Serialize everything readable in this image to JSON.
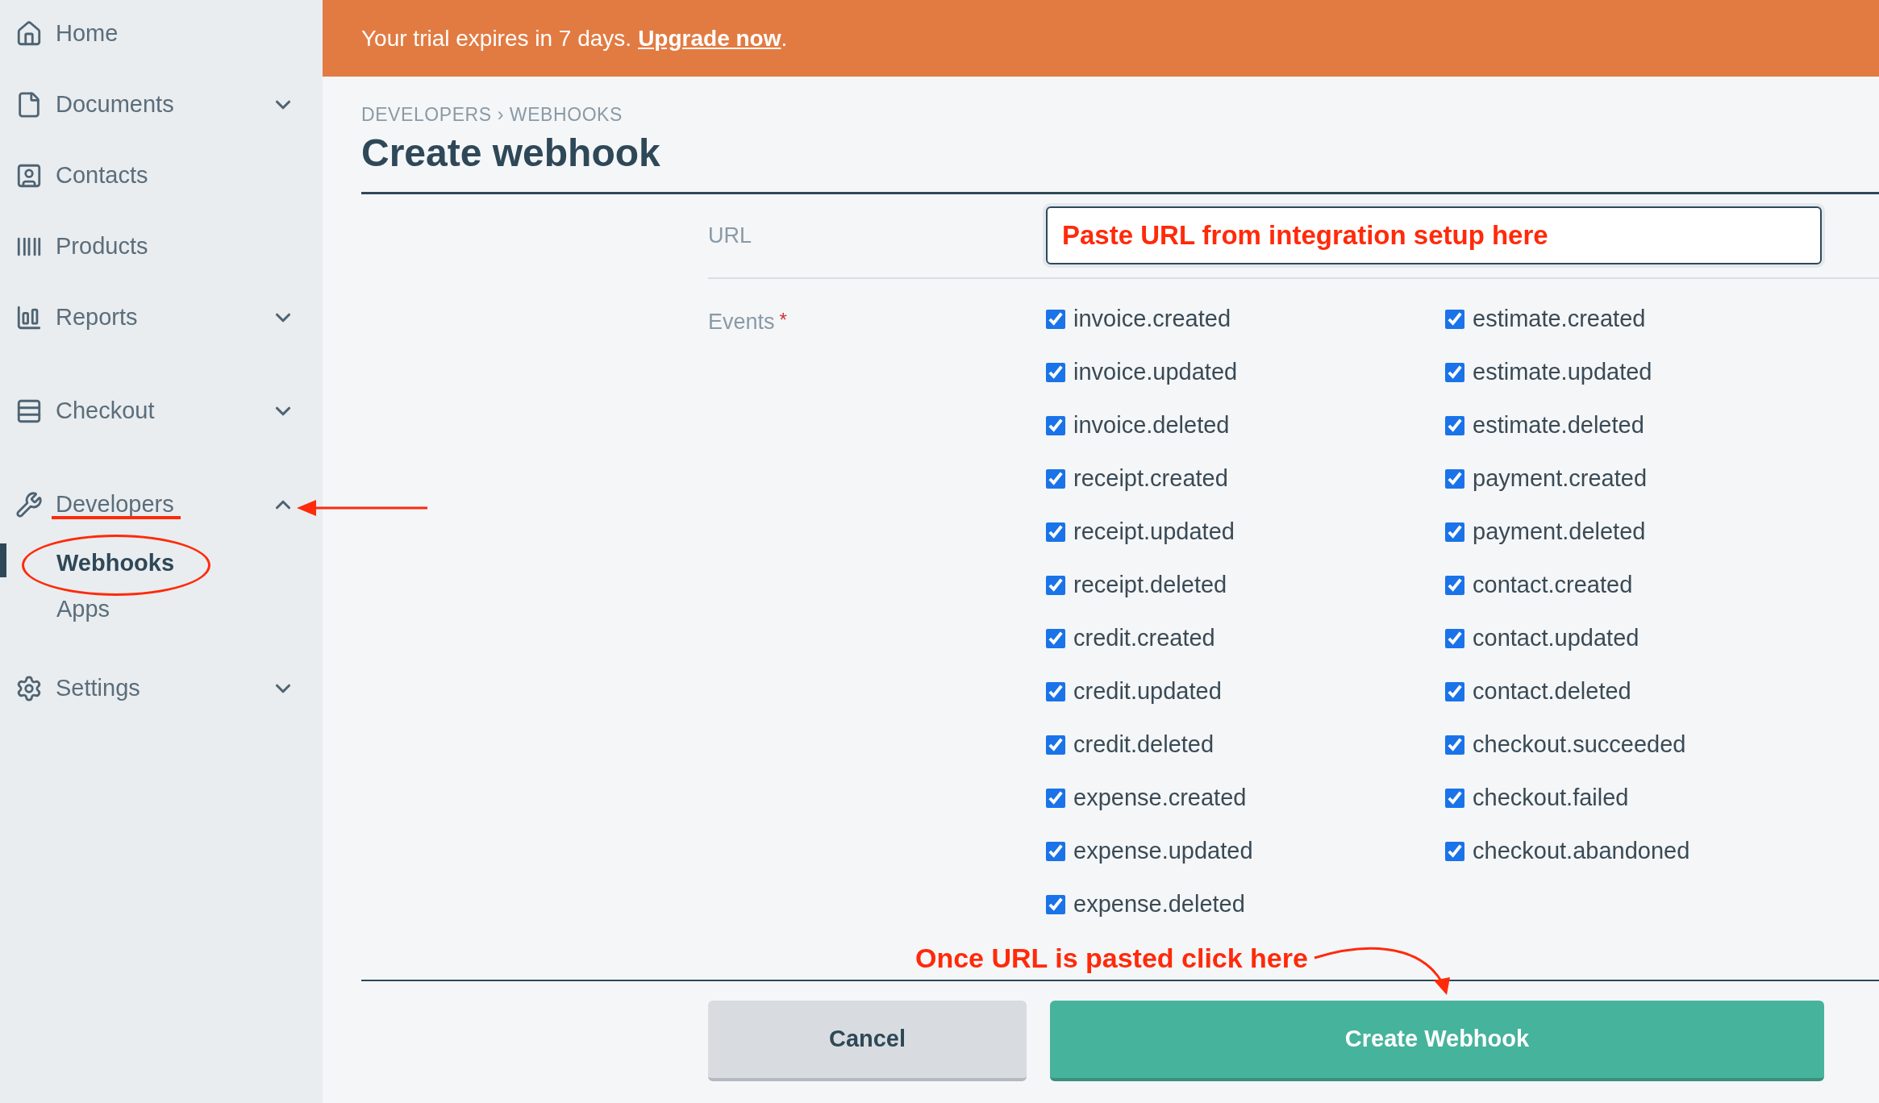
{
  "sidebar": {
    "items": [
      {
        "label": "Home",
        "kind": "link"
      },
      {
        "label": "Documents",
        "kind": "group",
        "expanded": false
      },
      {
        "label": "Contacts",
        "kind": "link"
      },
      {
        "label": "Products",
        "kind": "link"
      },
      {
        "label": "Reports",
        "kind": "group",
        "expanded": false
      },
      {
        "label": "Checkout",
        "kind": "group",
        "expanded": false
      },
      {
        "label": "Developers",
        "kind": "group",
        "expanded": true,
        "children": [
          {
            "label": "Webhooks",
            "selected": true
          },
          {
            "label": "Apps",
            "selected": false
          }
        ]
      },
      {
        "label": "Settings",
        "kind": "group",
        "expanded": false
      }
    ]
  },
  "banner": {
    "text": "Your trial expires in 7 days.",
    "link": "Upgrade now",
    "trailing": "."
  },
  "breadcrumb": "DEVELOPERS › WEBHOOKS",
  "title": "Create webhook",
  "url": {
    "label": "URL",
    "value": "Paste URL from integration setup here"
  },
  "events": {
    "label": "Events",
    "required_mark": "*",
    "columns": [
      [
        {
          "label": "invoice.created",
          "checked": true
        },
        {
          "label": "invoice.updated",
          "checked": true
        },
        {
          "label": "invoice.deleted",
          "checked": true
        },
        {
          "label": "receipt.created",
          "checked": true
        },
        {
          "label": "receipt.updated",
          "checked": true
        },
        {
          "label": "receipt.deleted",
          "checked": true
        },
        {
          "label": "credit.created",
          "checked": true
        },
        {
          "label": "credit.updated",
          "checked": true
        },
        {
          "label": "credit.deleted",
          "checked": true
        },
        {
          "label": "expense.created",
          "checked": true
        },
        {
          "label": "expense.updated",
          "checked": true
        },
        {
          "label": "expense.deleted",
          "checked": true
        }
      ],
      [
        {
          "label": "estimate.created",
          "checked": true
        },
        {
          "label": "estimate.updated",
          "checked": true
        },
        {
          "label": "estimate.deleted",
          "checked": true
        },
        {
          "label": "payment.created",
          "checked": true
        },
        {
          "label": "payment.deleted",
          "checked": true
        },
        {
          "label": "contact.created",
          "checked": true
        },
        {
          "label": "contact.updated",
          "checked": true
        },
        {
          "label": "contact.deleted",
          "checked": true
        },
        {
          "label": "checkout.succeeded",
          "checked": true
        },
        {
          "label": "checkout.failed",
          "checked": true
        },
        {
          "label": "checkout.abandoned",
          "checked": true
        }
      ]
    ]
  },
  "annotation": "Once URL is pasted click here",
  "buttons": {
    "cancel": "Cancel",
    "submit": "Create Webhook"
  }
}
